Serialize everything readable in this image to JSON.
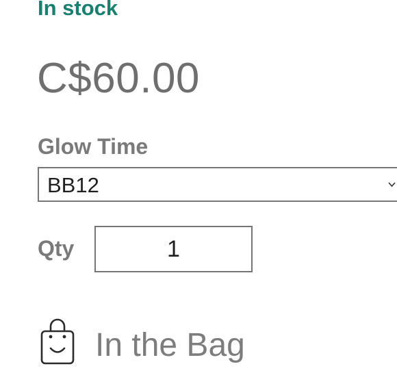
{
  "product": {
    "stock_status": "In stock",
    "price": "C$60.00"
  },
  "variant": {
    "label": "Glow Time",
    "selected": "BB12"
  },
  "quantity": {
    "label": "Qty",
    "value": "1"
  },
  "add_to_bag": {
    "label": "In the Bag",
    "icon": "shopping-bag-icon"
  },
  "colors": {
    "stock_green": "#17806f",
    "text_gray": "#6f6f6f",
    "border_gray": "#767676"
  }
}
